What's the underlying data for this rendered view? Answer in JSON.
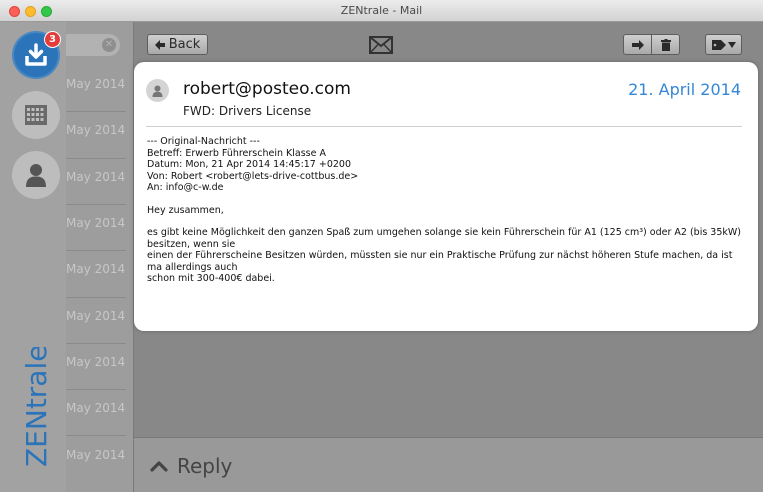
{
  "window": {
    "title": "ZENtrale - Mail"
  },
  "sidebar": {
    "inbox_badge": "3",
    "brand": "ZENtrale",
    "accent": "#2b74b9"
  },
  "list": {
    "search_clear": "✕",
    "items": [
      {
        "date": "May 2014"
      },
      {
        "date": "May 2014"
      },
      {
        "date": "May 2014"
      },
      {
        "date": "May 2014"
      },
      {
        "date": "May 2014"
      },
      {
        "date": "May 2014"
      },
      {
        "date": "May 2014"
      },
      {
        "date": "May 2014"
      },
      {
        "date": "May 2014"
      }
    ]
  },
  "toolbar": {
    "back_label": "Back",
    "icons": [
      "back-arrow-icon",
      "mail-icon",
      "forward-icon",
      "trash-icon",
      "tag-icon"
    ]
  },
  "message": {
    "sender": "robert@posteo.com",
    "date": "21. April 2014",
    "subject": "FWD: Drivers License",
    "date_color": "#3487d6",
    "lines": [
      "--- Original-Nachricht ---",
      "Betreff: Erwerb Führerschein Klasse A",
      "Datum: Mon, 21 Apr 2014 14:45:17 +0200",
      "Von: Robert <robert@lets-drive-cottbus.de>",
      "An: info@c-w.de",
      "",
      "Hey zusammen,",
      "",
      "es gibt keine Möglichkeit den ganzen Spaß zum umgehen solange sie kein Führerschein für A1 (125 cm³) oder A2 (bis 35kW) besitzen, wenn sie",
      "einen der Führerscheine Besitzen würden, müssten sie nur ein Praktische Prüfung zur nächst höheren Stufe machen, da ist ma allerdings auch",
      "schon mit 300-400€ dabei."
    ]
  },
  "reply": {
    "label": "Reply"
  }
}
